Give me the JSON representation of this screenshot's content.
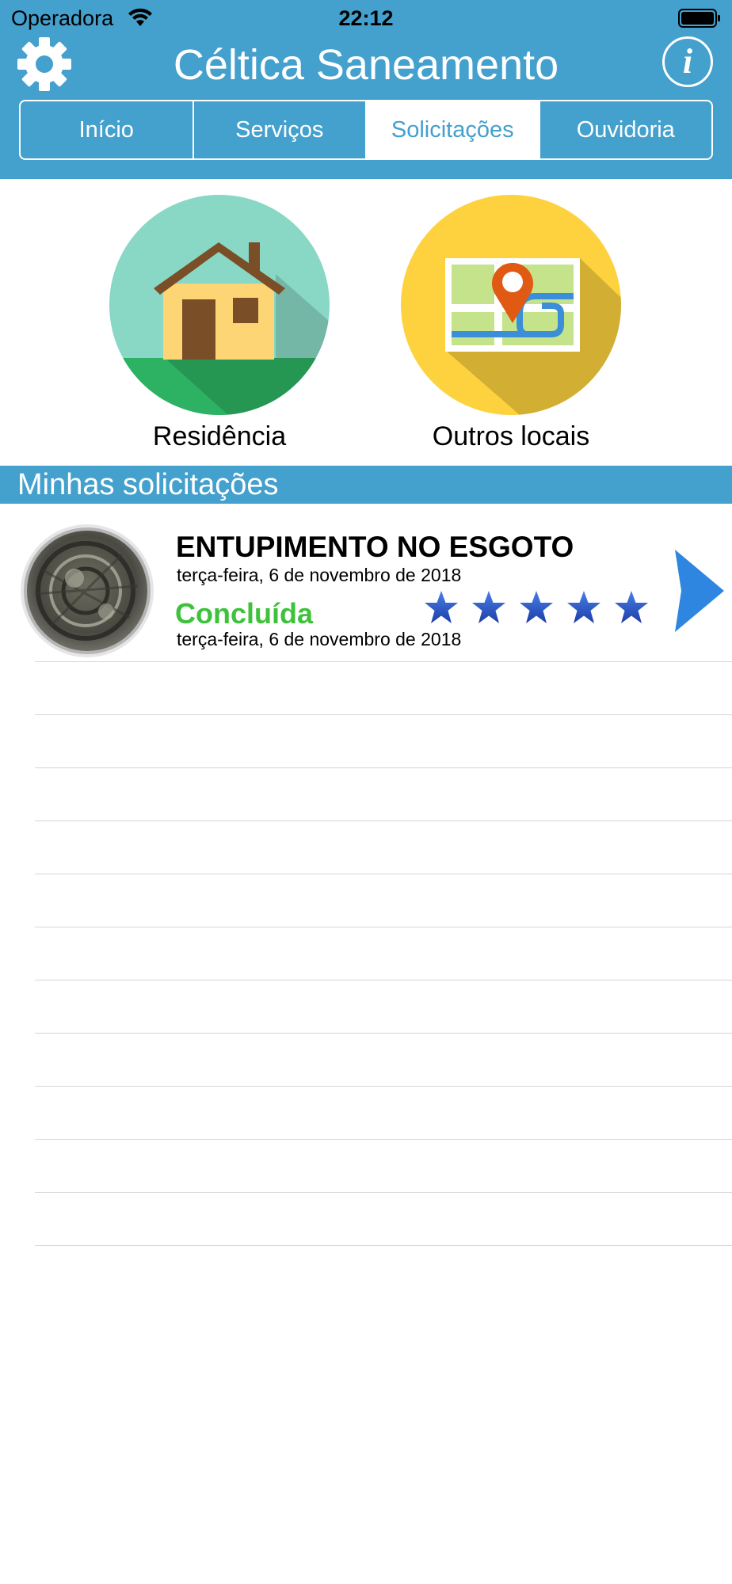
{
  "status_bar": {
    "carrier": "Operadora",
    "time": "22:12"
  },
  "header": {
    "title": "Céltica Saneamento",
    "info_label": "i",
    "background_color": "#44a0cc"
  },
  "tabs": [
    {
      "label": "Início",
      "active": false
    },
    {
      "label": "Serviços",
      "active": false
    },
    {
      "label": "Solicitações",
      "active": true
    },
    {
      "label": "Ouvidoria",
      "active": false
    }
  ],
  "options": {
    "residence": {
      "label": "Residência",
      "icon": "house-icon"
    },
    "other": {
      "label": "Outros locais",
      "icon": "map-pin-icon"
    }
  },
  "section": {
    "title": "Minhas solicitações"
  },
  "requests": [
    {
      "title": "ENTUPIMENTO NO ESGOTO",
      "created_date": "terça-feira, 6 de novembro de 2018",
      "status": "Concluída",
      "status_color": "#3fc23b",
      "status_date": "terça-feira, 6 de novembro de 2018",
      "rating": 5,
      "rating_max": 5
    }
  ]
}
